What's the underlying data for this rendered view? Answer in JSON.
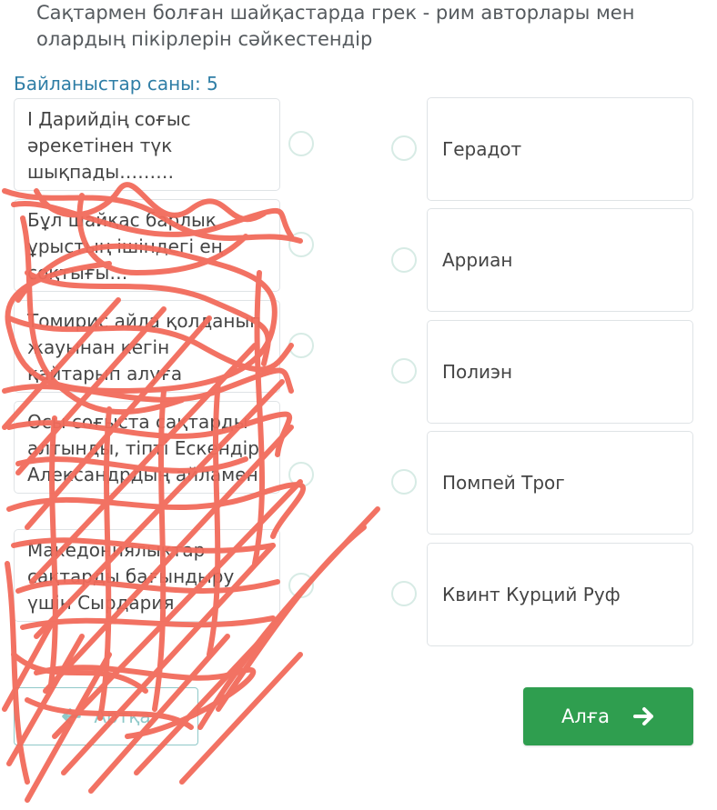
{
  "question": {
    "line1": "Сақтармен болған шайқастарда грек - рим авторлары мен",
    "line2": "олардың пікірлерін сәйкестендір"
  },
  "counter": "Байланыстар саны: 5",
  "left_items": [
    {
      "text": "І Дарийдің соғыс әрекетінен түк шықпады………"
    },
    {
      "text": "Бұл шайқас барлық ұрыстың ішіндегі ең соқтығы…"
    },
    {
      "text": "Томирис айла қолданып жауынан кегін қайтарып алуға болады…"
    },
    {
      "text": "Осы соғыста сақтарды алтынды, тіпті Ескендір Александрдың айламен жаулап қайтқанын"
    },
    {
      "text": "Македониялықтар сақтарды бағындыру үшін Сырдария жағасына барып соғыс ашады….."
    }
  ],
  "right_items": [
    {
      "text": "Герадот"
    },
    {
      "text": "Арриан"
    },
    {
      "text": "Полиэн"
    },
    {
      "text": "Помпей Трог"
    },
    {
      "text": "Квинт Курций Руф"
    }
  ],
  "buttons": {
    "back_label": "Артқа",
    "next_label": "Алға"
  },
  "colors": {
    "accent_green": "#2f9e4f",
    "counter_blue": "#2f7ea6",
    "scribble": "#f26b5b"
  }
}
